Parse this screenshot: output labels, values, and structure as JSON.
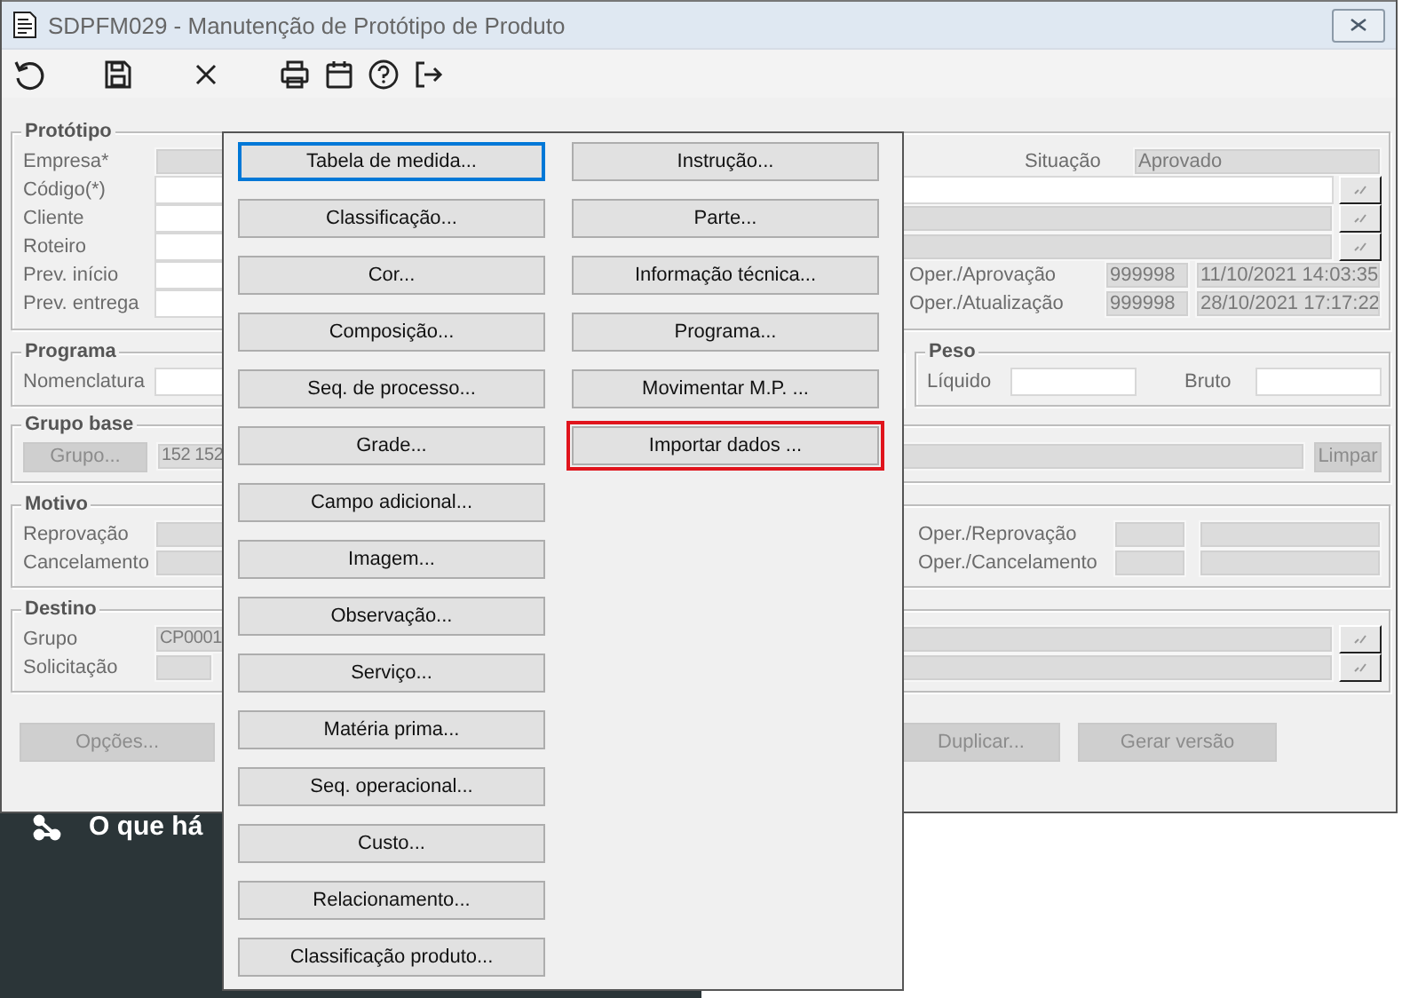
{
  "window": {
    "title": "SDPFM029 - Manutenção de Protótipo de Produto"
  },
  "toolbar": [
    {
      "kind": "undo"
    },
    {
      "kind": "save"
    },
    {
      "kind": "close"
    },
    {
      "kind": "print"
    },
    {
      "kind": "calendar"
    },
    {
      "kind": "help"
    },
    {
      "kind": "exit"
    }
  ],
  "prototipo": {
    "legend": "Protótipo",
    "empresa_label": "Empresa*",
    "codigo_label": "Código(*)",
    "cliente_label": "Cliente",
    "roteiro_label": "Roteiro",
    "prev_inicio_label": "Prev. início",
    "prev_entrega_label": "Prev. entrega",
    "situacao_label": "Situação",
    "situacao_value": "Aprovado",
    "oper_aprovacao": {
      "label": "Oper./Aprovação",
      "operator": "999998",
      "datetime": "11/10/2021 14:03:35"
    },
    "oper_atualizacao": {
      "label": "Oper./Atualização",
      "operator": "999998",
      "datetime": "28/10/2021 17:17:22"
    }
  },
  "programa": {
    "legend": "Programa",
    "nomenclatura_label": "Nomenclatura"
  },
  "peso": {
    "legend": "Peso",
    "liquido_label": "Líquido",
    "bruto_label": "Bruto"
  },
  "grupo_base": {
    "legend": "Grupo base",
    "grupo_button": {
      "label": "Grupo...",
      "disabled": true
    },
    "value": "152 152",
    "limpar_button": {
      "label": "Limpar",
      "disabled": true
    }
  },
  "motivo": {
    "legend": "Motivo",
    "reprovacao_label": "Reprovação",
    "cancelamento_label": "Cancelamento",
    "oper_reprovacao_label": "Oper./Reprovação",
    "oper_cancelamento_label": "Oper./Cancelamento"
  },
  "destino": {
    "legend": "Destino",
    "grupo_label": "Grupo",
    "grupo_value": "CP0001",
    "solicitacao_label": "Solicitação"
  },
  "footer_buttons": [
    {
      "label": "Opções...",
      "disabled": true
    },
    {
      "label": "Duplicar...",
      "disabled": true
    },
    {
      "label": "Gerar versão",
      "disabled": true
    }
  ],
  "options_menu": {
    "columns": [
      [
        {
          "label": "Tabela de medida...",
          "focused": true,
          "highlighted": false
        },
        {
          "label": "Classificação...",
          "focused": false,
          "highlighted": false
        },
        {
          "label": "Cor...",
          "focused": false,
          "highlighted": false
        },
        {
          "label": "Composição...",
          "focused": false,
          "highlighted": false
        },
        {
          "label": "Seq. de processo...",
          "focused": false,
          "highlighted": false
        },
        {
          "label": "Grade...",
          "focused": false,
          "highlighted": false
        },
        {
          "label": "Campo adicional...",
          "focused": false,
          "highlighted": false
        },
        {
          "label": "Imagem...",
          "focused": false,
          "highlighted": false
        },
        {
          "label": "Observação...",
          "focused": false,
          "highlighted": false
        },
        {
          "label": "Serviço...",
          "focused": false,
          "highlighted": false
        },
        {
          "label": "Matéria prima...",
          "focused": false,
          "highlighted": false
        },
        {
          "label": "Seq. operacional...",
          "focused": false,
          "highlighted": false
        },
        {
          "label": "Custo...",
          "focused": false,
          "highlighted": false
        },
        {
          "label": "Relacionamento...",
          "focused": false,
          "highlighted": false
        },
        {
          "label": "Classificação produto...",
          "focused": false,
          "highlighted": false
        }
      ],
      [
        {
          "label": "Instrução...",
          "focused": false,
          "highlighted": false
        },
        {
          "label": "Parte...",
          "focused": false,
          "highlighted": false
        },
        {
          "label": "Informação técnica...",
          "focused": false,
          "highlighted": false
        },
        {
          "label": "Programa...",
          "focused": false,
          "highlighted": false
        },
        {
          "label": "Movimentar M.P. ...",
          "focused": false,
          "highlighted": false
        },
        {
          "label": "Importar dados ...",
          "focused": false,
          "highlighted": true
        }
      ]
    ]
  },
  "background": {
    "text": "O que há"
  }
}
